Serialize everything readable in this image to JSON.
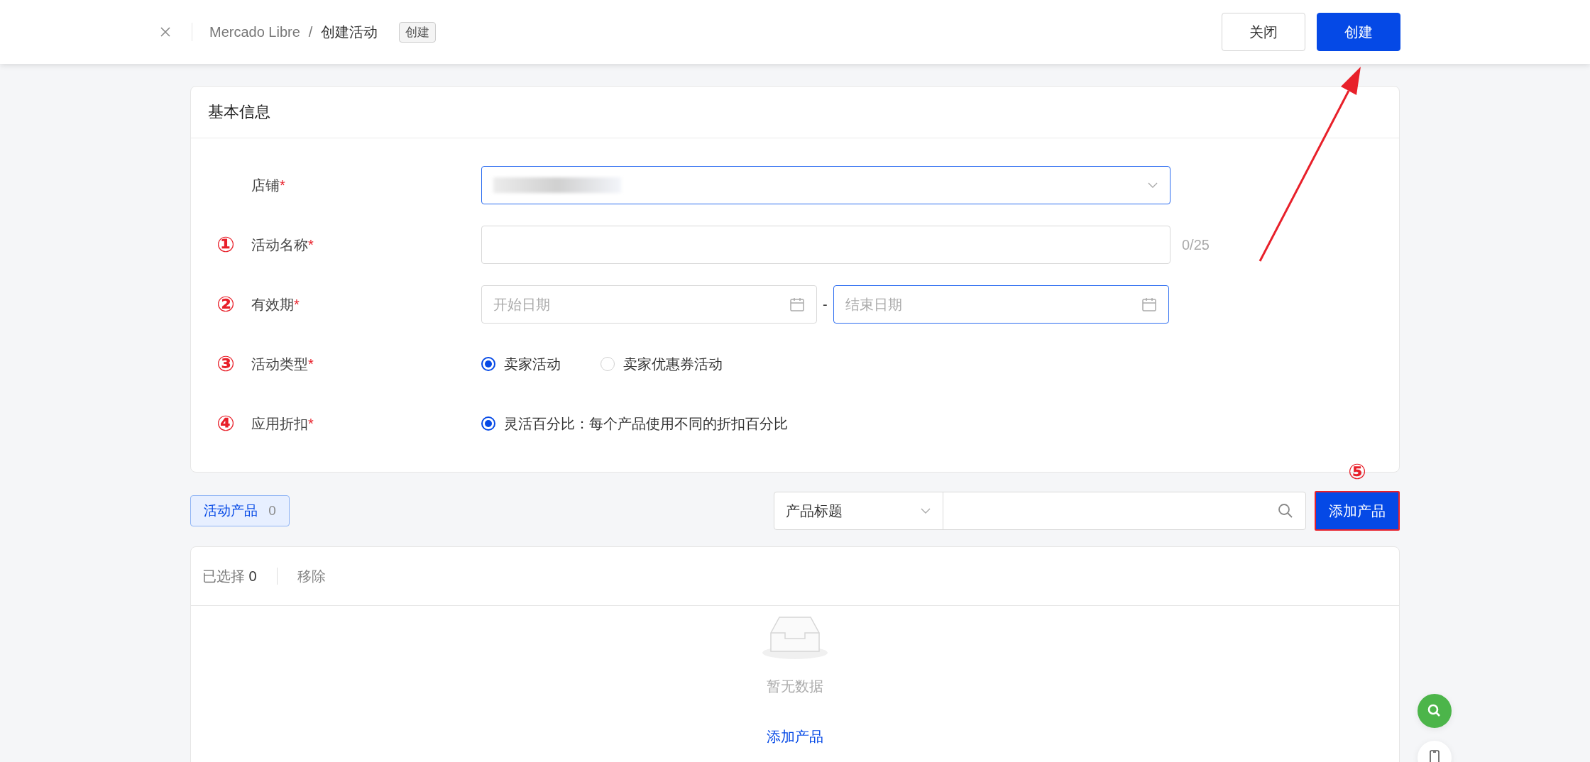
{
  "header": {
    "breadcrumb": [
      "Mercado Libre",
      "创建活动"
    ],
    "separator": "/",
    "badge": "创建",
    "buttons": [
      {
        "label": "关闭",
        "kind": "default"
      },
      {
        "label": "创建",
        "kind": "primary"
      }
    ]
  },
  "basic_info": {
    "title": "基本信息",
    "required_mark": "*",
    "fields": [
      {
        "kind": "select",
        "label": "店铺",
        "active": true,
        "redacted": true
      },
      {
        "kind": "text",
        "marker": "①",
        "label": "活动名称",
        "counter": "0/25"
      },
      {
        "kind": "date_range",
        "marker": "②",
        "label": "有效期",
        "start_placeholder": "开始日期",
        "separator": "-",
        "end_placeholder": "结束日期",
        "end_active": true
      },
      {
        "kind": "radio",
        "marker": "③",
        "label": "活动类型",
        "options": [
          {
            "label": "卖家活动",
            "selected": true
          },
          {
            "label": "卖家优惠券活动",
            "selected": false
          }
        ]
      },
      {
        "kind": "radio",
        "marker": "④",
        "label": "应用折扣",
        "options": [
          {
            "label": "灵活百分比：每个产品使用不同的折扣百分比",
            "selected": true
          }
        ]
      }
    ]
  },
  "products": {
    "tab": {
      "label": "活动产品",
      "count": "0",
      "selected": true
    },
    "filter": {
      "value": "产品标题"
    },
    "add_button": {
      "label": "添加产品",
      "marker": "⑤",
      "highlighted": true
    },
    "toolbar": {
      "selected_label": "已选择",
      "selected_count": "0",
      "remove": "移除"
    },
    "empty": {
      "text": "暂无数据",
      "link": "添加产品"
    }
  }
}
